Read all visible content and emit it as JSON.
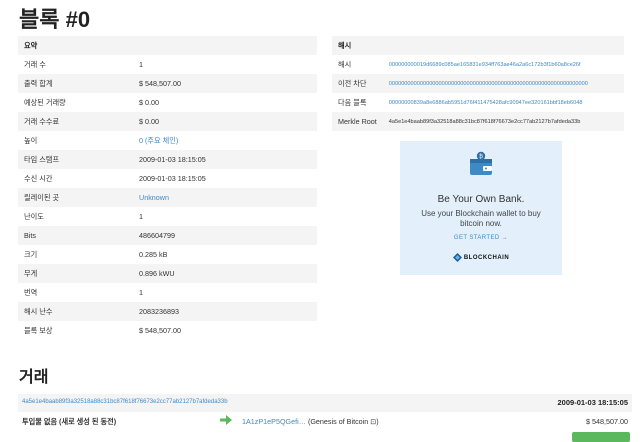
{
  "page_title": "블록 #0",
  "summary": {
    "header": "요약",
    "rows": [
      {
        "label": "거래 수",
        "value": "1"
      },
      {
        "label": "출력 합계",
        "value": "$ 548,507.00"
      },
      {
        "label": "예상된 거래량",
        "value": "$ 0.00"
      },
      {
        "label": "거래 수수료",
        "value": "$ 0.00"
      },
      {
        "label": "높이",
        "value": "0 (주요 체인)"
      },
      {
        "label": "타임 스탬프",
        "value": "2009-01-03 18:15:05"
      },
      {
        "label": "수신 시간",
        "value": "2009-01-03 18:15:05"
      },
      {
        "label": "릴레이된 곳",
        "value": "Unknown"
      },
      {
        "label": "난이도",
        "value": "1"
      },
      {
        "label": "Bits",
        "value": "486604799"
      },
      {
        "label": "크기",
        "value": "0.285 kB"
      },
      {
        "label": "무게",
        "value": "0.896 kWU"
      },
      {
        "label": "번역",
        "value": "1"
      },
      {
        "label": "해시 난수",
        "value": "2083236893"
      },
      {
        "label": "블록 보상",
        "value": "$ 548,507.00"
      }
    ]
  },
  "hashes": {
    "header": "해시",
    "rows": [
      {
        "label": "해시",
        "value": "000000000019d6689c085ae165831e934ff763ae46a2a6c172b3f1b60a8ce26f"
      },
      {
        "label": "이전 차단",
        "value": "0000000000000000000000000000000000000000000000000000000000000000"
      },
      {
        "label": "다음 블록",
        "value": "00000000839a8e6886ab5951d76f411475428afc90947ee320161bbf18eb6048"
      },
      {
        "label": "Merkle Root",
        "value": "4a5e1e4baab89f3a32518a88c31bc87f618f76673e2cc77ab2127b7afdeda33b"
      }
    ]
  },
  "ad": {
    "headline": "Be Your Own Bank.",
    "body": "Use your Blockchain wallet to buy bitcoin now.",
    "cta": "GET STARTED →",
    "brand": "BLOCKCHAIN"
  },
  "transactions": {
    "title": "거래",
    "items": [
      {
        "hash": "4a5e1e4baab89f3a32518a88c31bc87f618f76673e2cc77ab2127b7afdeda33b",
        "time": "2009-01-03 18:15:05",
        "from": "투입물 없음 (새로 생성 된 동전)",
        "to_address": "1A1zP1eP5QGefi…",
        "to_note": "(Genesis of Bitcoin ⊡)",
        "amount": "$ 548,507.00"
      }
    ]
  },
  "colors": {
    "link": "#3d8ac7",
    "stripe": "#f4f4f4",
    "ad_background": "#e3f0fb",
    "arrow": "#5cb85c"
  }
}
